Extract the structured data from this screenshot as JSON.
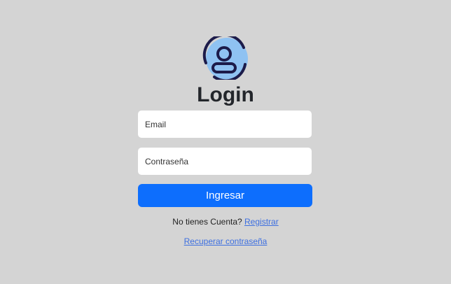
{
  "login": {
    "title": "Login",
    "email_placeholder": "Email",
    "password_placeholder": "Contraseña",
    "submit_label": "Ingresar",
    "no_account_text": "No tienes Cuenta? ",
    "register_link": "Registrar",
    "recover_link": "Recuperar contraseña"
  },
  "icons": {
    "logo": "user-avatar-icon"
  },
  "colors": {
    "background": "#d4d4d4",
    "primary": "#0d6efd",
    "link": "#3d6fe0",
    "logo_fill": "#8fc2f2",
    "logo_stroke": "#1c1b4a"
  }
}
